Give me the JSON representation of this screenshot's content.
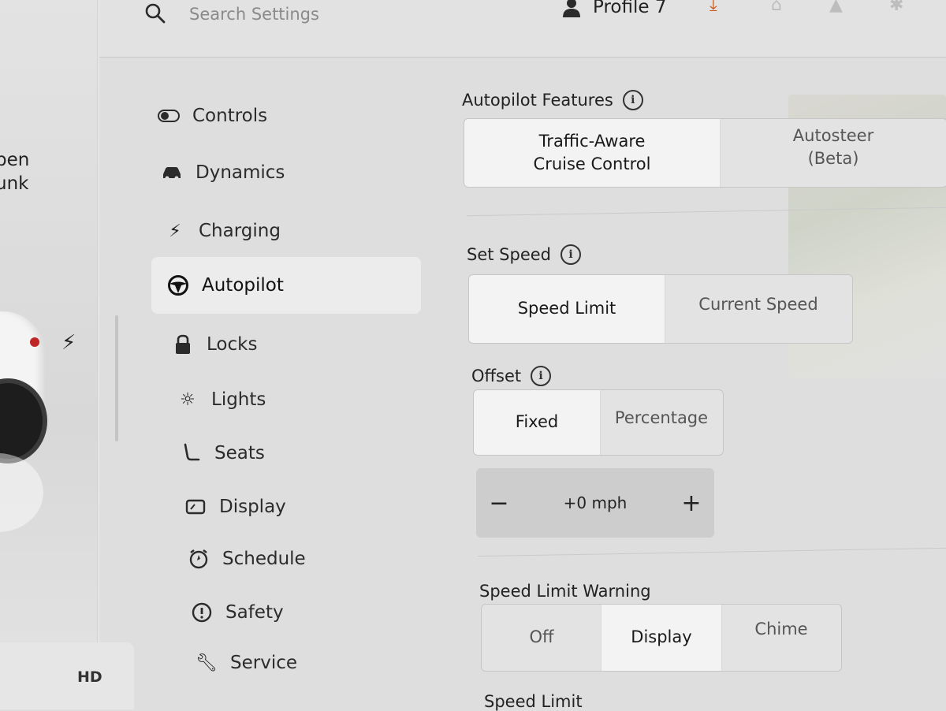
{
  "car": {
    "trunk_line1": "pen",
    "trunk_line2": "unk",
    "hd_icon": "HD"
  },
  "topbar": {
    "search": {
      "placeholder": "Search Settings",
      "icon": "search-icon"
    },
    "profile": {
      "label": "Profile 7",
      "icon": "person-icon"
    },
    "status_icons": [
      "download-icon",
      "garage-icon",
      "bell-icon",
      "bluetooth-icon"
    ]
  },
  "nav": {
    "items": [
      {
        "id": "controls",
        "label": "Controls",
        "icon": "toggle-icon"
      },
      {
        "id": "dynamics",
        "label": "Dynamics",
        "icon": "car-icon"
      },
      {
        "id": "charging",
        "label": "Charging",
        "icon": "bolt-icon"
      },
      {
        "id": "autopilot",
        "label": "Autopilot",
        "icon": "steering-wheel-icon",
        "active": true
      },
      {
        "id": "locks",
        "label": "Locks",
        "icon": "lock-icon"
      },
      {
        "id": "lights",
        "label": "Lights",
        "icon": "sun-icon"
      },
      {
        "id": "seats",
        "label": "Seats",
        "icon": "seat-icon"
      },
      {
        "id": "display",
        "label": "Display",
        "icon": "display-icon"
      },
      {
        "id": "schedule",
        "label": "Schedule",
        "icon": "alarm-clock-icon"
      },
      {
        "id": "safety",
        "label": "Safety",
        "icon": "alert-circle-icon"
      },
      {
        "id": "service",
        "label": "Service",
        "icon": "wrench-icon"
      }
    ]
  },
  "autopilot": {
    "features": {
      "label": "Autopilot Features",
      "options": [
        "Traffic-Aware\nCruise Control",
        "Autosteer\n(Beta)"
      ],
      "selected": "Traffic-Aware\nCruise Control"
    },
    "set_speed": {
      "label": "Set Speed",
      "options": [
        "Speed Limit",
        "Current Speed"
      ],
      "selected": "Speed Limit"
    },
    "offset": {
      "label": "Offset",
      "options": [
        "Fixed",
        "Percentage"
      ],
      "selected": "Fixed",
      "stepper": {
        "minus": "−",
        "value": "+0 mph",
        "plus": "+"
      }
    },
    "speed_limit_warning": {
      "label": "Speed Limit Warning",
      "options": [
        "Off",
        "Display",
        "Chime"
      ],
      "selected": "Display"
    },
    "speed_limit": {
      "label": "Speed Limit"
    }
  },
  "colors": {
    "accent_download": "#c75a1a",
    "selected_segment": "#f3f3f3",
    "panel_bg": "#dedede"
  }
}
